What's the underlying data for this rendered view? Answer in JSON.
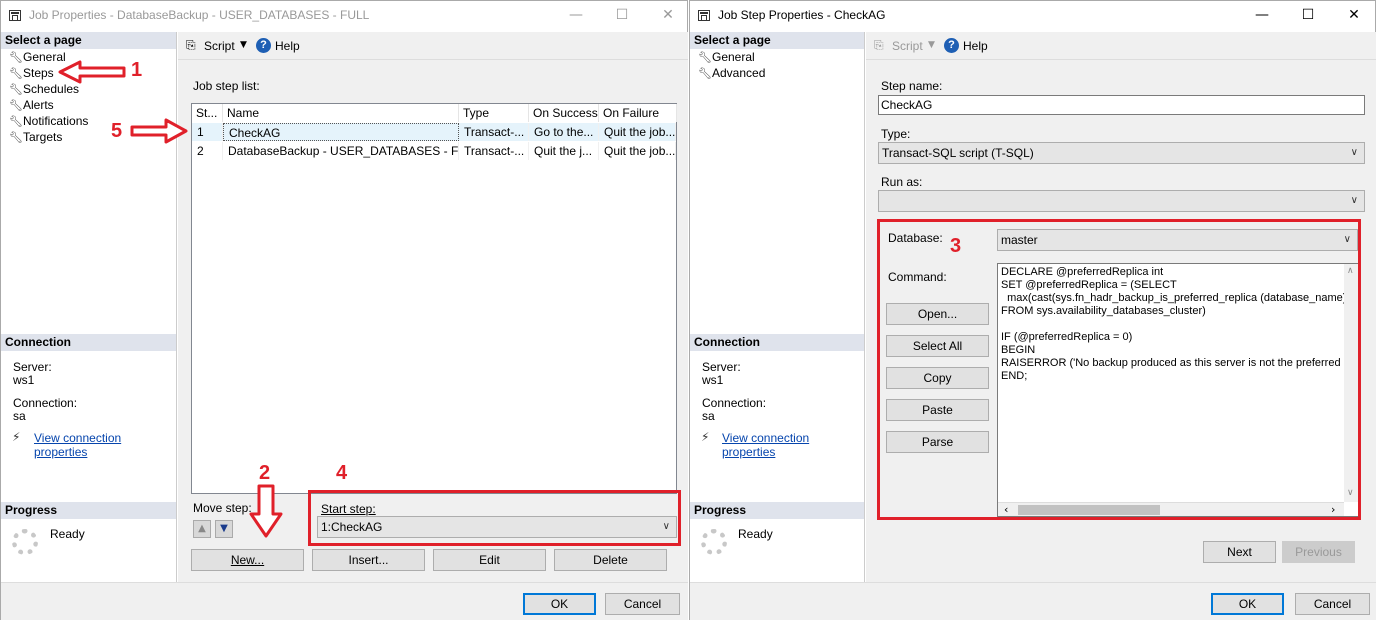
{
  "left_window": {
    "title": "Job Properties - DatabaseBackup - USER_DATABASES - FULL",
    "controls": {
      "minimize": "—",
      "maximize": "☐",
      "close": "✕"
    },
    "select_page_header": "Select a page",
    "pages": [
      "General",
      "Steps",
      "Schedules",
      "Alerts",
      "Notifications",
      "Targets"
    ],
    "connection_header": "Connection",
    "server_label": "Server:",
    "server_value": "ws1",
    "connection_label": "Connection:",
    "connection_value": "sa",
    "view_connection_link": "View connection properties",
    "progress_header": "Progress",
    "progress_status": "Ready",
    "toolbar": {
      "script_label": "Script",
      "help_label": "Help"
    },
    "job_step_list_label": "Job step list:",
    "grid": {
      "columns": [
        "St...",
        "Name",
        "Type",
        "On Success",
        "On Failure"
      ],
      "rows": [
        [
          "1",
          "CheckAG",
          "Transact-...",
          "Go to the...",
          "Quit the job..."
        ],
        [
          "2",
          "DatabaseBackup - USER_DATABASES - F...",
          "Transact-...",
          "Quit the j...",
          "Quit the job..."
        ]
      ]
    },
    "move_step_label": "Move step:",
    "start_step_label": "Start step:",
    "start_step_value": "1:CheckAG",
    "buttons": {
      "new": "New...",
      "insert": "Insert...",
      "edit": "Edit",
      "delete": "Delete",
      "ok": "OK",
      "cancel": "Cancel"
    }
  },
  "right_window": {
    "title": "Job Step Properties - CheckAG",
    "controls": {
      "minimize": "—",
      "maximize": "☐",
      "close": "✕"
    },
    "select_page_header": "Select a page",
    "pages": [
      "General",
      "Advanced"
    ],
    "connection_header": "Connection",
    "server_label": "Server:",
    "server_value": "ws1",
    "connection_label": "Connection:",
    "connection_value": "sa",
    "view_connection_link": "View connection properties",
    "progress_header": "Progress",
    "progress_status": "Ready",
    "toolbar": {
      "script_label": "Script",
      "help_label": "Help"
    },
    "step_name_label": "Step name:",
    "step_name_value": "CheckAG",
    "type_label": "Type:",
    "type_value": "Transact-SQL script (T-SQL)",
    "run_as_label": "Run as:",
    "run_as_value": "",
    "database_label": "Database:",
    "database_value": "master",
    "command_label": "Command:",
    "command_buttons": {
      "open": "Open...",
      "select_all": "Select All",
      "copy": "Copy",
      "paste": "Paste",
      "parse": "Parse"
    },
    "command_text": "DECLARE @preferredReplica int\nSET @preferredReplica = (SELECT\n  max(cast(sys.fn_hadr_backup_is_preferred_replica (database_name) a\nFROM sys.availability_databases_cluster)\n\nIF (@preferredReplica = 0)\nBEGIN\nRAISERROR ('No backup produced as this server is not the preferred re\nEND;",
    "buttons": {
      "next": "Next",
      "previous": "Previous",
      "ok": "OK",
      "cancel": "Cancel"
    }
  },
  "annotations": [
    "1",
    "2",
    "3",
    "4",
    "5"
  ],
  "colors": {
    "annotation_red": "#e0202a",
    "section_header_bg": "#dfe3ec",
    "primary_button_border": "#0078d7",
    "link": "#0645ad"
  }
}
